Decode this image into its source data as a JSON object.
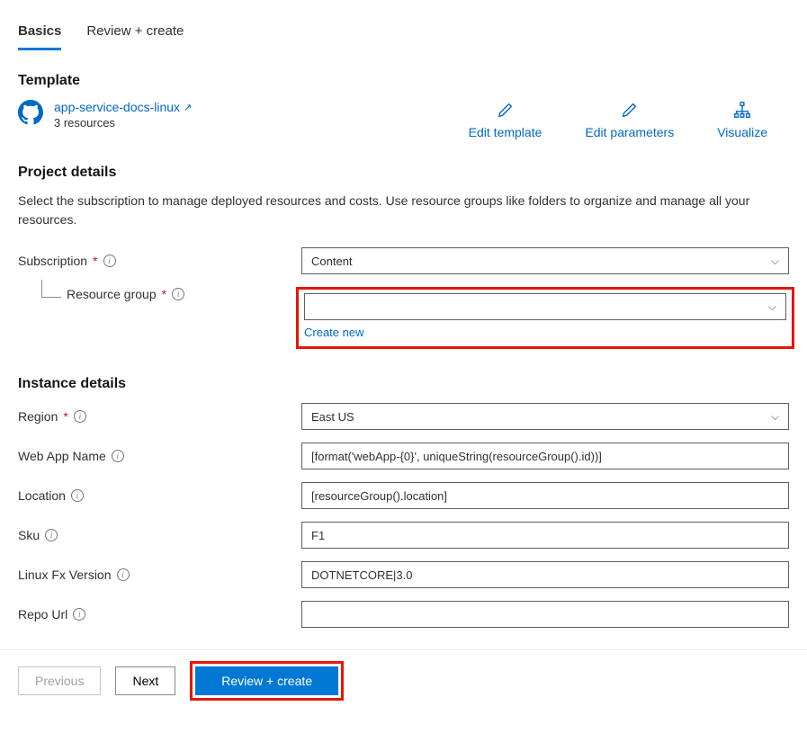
{
  "tabs": {
    "basics": "Basics",
    "review": "Review + create"
  },
  "template": {
    "heading": "Template",
    "link": "app-service-docs-linux",
    "resources": "3 resources",
    "actions": {
      "edit_template": "Edit template",
      "edit_parameters": "Edit parameters",
      "visualize": "Visualize"
    }
  },
  "project": {
    "heading": "Project details",
    "desc": "Select the subscription to manage deployed resources and costs. Use resource groups like folders to organize and manage all your resources.",
    "subscription_label": "Subscription",
    "subscription_value": "Content",
    "resource_group_label": "Resource group",
    "resource_group_value": "",
    "create_new": "Create new"
  },
  "instance": {
    "heading": "Instance details",
    "region_label": "Region",
    "region_value": "East US",
    "webapp_label": "Web App Name",
    "webapp_value": "[format('webApp-{0}', uniqueString(resourceGroup().id))]",
    "location_label": "Location",
    "location_value": "[resourceGroup().location]",
    "sku_label": "Sku",
    "sku_value": "F1",
    "linuxfx_label": "Linux Fx Version",
    "linuxfx_value": "DOTNETCORE|3.0",
    "repo_label": "Repo Url",
    "repo_value": ""
  },
  "footer": {
    "previous": "Previous",
    "next": "Next",
    "review": "Review + create"
  }
}
